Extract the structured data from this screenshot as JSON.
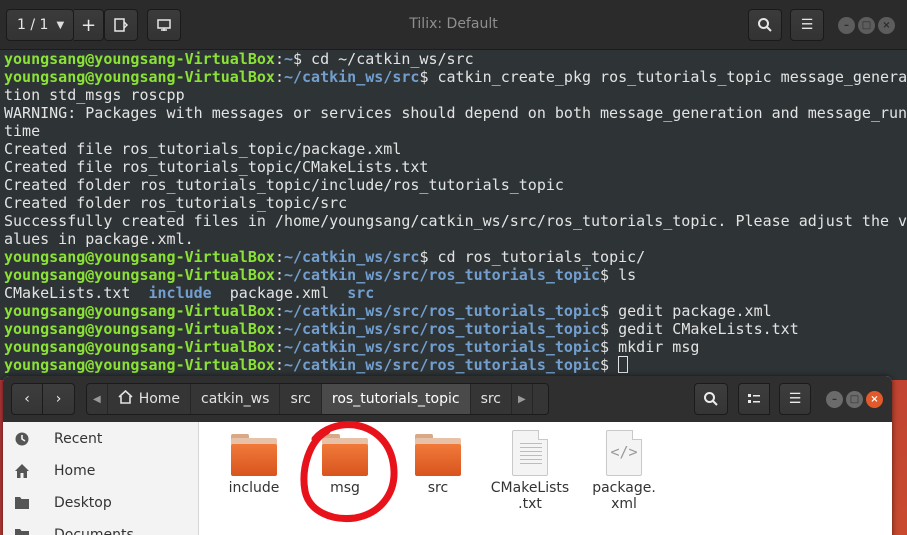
{
  "terminal": {
    "session_label": "1 / 1",
    "title": "Tilix: Default",
    "lines": [
      {
        "user": "youngsang@youngsang-VirtualBox",
        "path": "~",
        "cmd": " cd ~/catkin_ws/src"
      },
      {
        "user": "youngsang@youngsang-VirtualBox",
        "path": "~/catkin_ws/src",
        "cmd": " catkin_create_pkg ros_tutorials_topic message_genera"
      },
      {
        "text": "tion std_msgs roscpp"
      },
      {
        "text": "WARNING: Packages with messages or services should depend on both message_generation and message_run"
      },
      {
        "text": "time"
      },
      {
        "text": "Created file ros_tutorials_topic/package.xml"
      },
      {
        "text": "Created file ros_tutorials_topic/CMakeLists.txt"
      },
      {
        "text": "Created folder ros_tutorials_topic/include/ros_tutorials_topic"
      },
      {
        "text": "Created folder ros_tutorials_topic/src"
      },
      {
        "text": "Successfully created files in /home/youngsang/catkin_ws/src/ros_tutorials_topic. Please adjust the v"
      },
      {
        "text": "alues in package.xml."
      },
      {
        "user": "youngsang@youngsang-VirtualBox",
        "path": "~/catkin_ws/src",
        "cmd": " cd ros_tutorials_topic/"
      },
      {
        "user": "youngsang@youngsang-VirtualBox",
        "path": "~/catkin_ws/src/ros_tutorials_topic",
        "cmd": " ls"
      },
      {
        "ls": [
          {
            "name": "CMakeLists.txt",
            "dir": false
          },
          {
            "name": "include",
            "dir": true
          },
          {
            "name": "package.xml",
            "dir": false
          },
          {
            "name": "src",
            "dir": true
          }
        ]
      },
      {
        "user": "youngsang@youngsang-VirtualBox",
        "path": "~/catkin_ws/src/ros_tutorials_topic",
        "cmd": " gedit package.xml"
      },
      {
        "user": "youngsang@youngsang-VirtualBox",
        "path": "~/catkin_ws/src/ros_tutorials_topic",
        "cmd": " gedit CMakeLists.txt"
      },
      {
        "user": "youngsang@youngsang-VirtualBox",
        "path": "~/catkin_ws/src/ros_tutorials_topic",
        "cmd": " mkdir msg"
      },
      {
        "user": "youngsang@youngsang-VirtualBox",
        "path": "~/catkin_ws/src/ros_tutorials_topic",
        "cmd": " ",
        "cursor": true
      }
    ]
  },
  "files": {
    "breadcrumbs": [
      {
        "label": "Home",
        "home": true,
        "active": false
      },
      {
        "label": "catkin_ws",
        "active": false
      },
      {
        "label": "src",
        "active": false
      },
      {
        "label": "ros_tutorials_topic",
        "active": true
      },
      {
        "label": "src",
        "active": false
      }
    ],
    "sidebar": [
      {
        "label": "Recent",
        "icon": "clock-icon"
      },
      {
        "label": "Home",
        "icon": "home-icon"
      },
      {
        "label": "Desktop",
        "icon": "folder-icon"
      },
      {
        "label": "Documents",
        "icon": "folder-icon"
      }
    ],
    "items": [
      {
        "label": "include",
        "kind": "folder"
      },
      {
        "label": "msg",
        "kind": "folder"
      },
      {
        "label": "src",
        "kind": "folder"
      },
      {
        "label": "CMakeLists\n.txt",
        "kind": "text"
      },
      {
        "label": "package.\nxml",
        "kind": "xml"
      }
    ]
  },
  "colors": {
    "prompt_user": "#8ae234",
    "prompt_path": "#729fcf",
    "folder_orange": "#e8672a",
    "annotation_red": "#e8131a"
  }
}
